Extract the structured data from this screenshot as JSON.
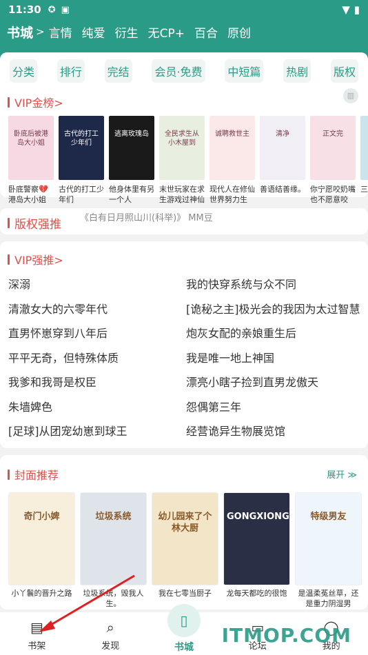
{
  "status": {
    "time": "11:30"
  },
  "topnav": {
    "main": "书城",
    "items": [
      "言情",
      "纯爱",
      "衍生",
      "无CP+",
      "百合",
      "原创"
    ]
  },
  "tabs": [
    "分类",
    "排行",
    "完结",
    "会员·免费",
    "中短篇",
    "热剧",
    "版权"
  ],
  "vip_rank": {
    "title": "VIP金榜>",
    "books": [
      {
        "title": "卧底警察💔港岛大小姐",
        "cover": "#f6d9e2",
        "cover_text": "卧底后被港岛大小姐"
      },
      {
        "title": "古代的打工少年们",
        "cover": "#1e2848",
        "cover_text": "古代的打工少年们"
      },
      {
        "title": "他身体里有另一个人",
        "cover": "#1a1a1a",
        "cover_text": "逃离玫瑰岛"
      },
      {
        "title": "末世玩家在求生游戏过神仙",
        "cover": "#e9efe0",
        "cover_text": "全民求生从小木屋到"
      },
      {
        "title": "现代人在修仙世界努力生",
        "cover": "#fbe9e9",
        "cover_text": "诚聘救世主"
      },
      {
        "title": "善语结善缘。",
        "cover": "#f2eef5",
        "cover_text": "清净"
      },
      {
        "title": "你宁愿咬奶嘴也不愿意咬",
        "cover": "#f8e1e6",
        "cover_text": "正文完"
      },
      {
        "title": "三",
        "cover": "#c9e4ea",
        "cover_text": ""
      }
    ]
  },
  "copyright": {
    "title": "版权强推",
    "scroll": "《白有日月照山川(科举)》 MM豆"
  },
  "vip_push": {
    "title": "VIP强推>",
    "left": [
      "深溺",
      "清澈女大的六零年代",
      "直男怀崽穿到八年后",
      "平平无奇，但特殊体质",
      "我爹和我哥是权臣",
      "朱墙婢色",
      "[足球]从团宠幼崽到球王"
    ],
    "right": [
      "我的快穿系统与众不同",
      "[诡秘之主]极光会的我因为太过智慧",
      "炮灰女配的亲娘重生后",
      "我是唯一地上神国",
      "漂亮小瞎子捡到直男龙傲天",
      "怨偶第三年",
      "经营诡异生物展览馆"
    ]
  },
  "cover_recommend": {
    "title": "封面推荐",
    "expand_label": "展开 ≫",
    "books": [
      {
        "title": "小丫鬟的晋升之路",
        "cover": "#f7eedc",
        "cover_text": "奇门小婢"
      },
      {
        "title": "垃圾系统，毁我人生。",
        "cover": "#dfe3ea",
        "cover_text": "垃圾系统"
      },
      {
        "title": "我在七零当厨子",
        "cover": "#f3e6c8",
        "cover_text": "幼儿园来了个林大厨"
      },
      {
        "title": "龙每天都吃的很饱",
        "cover": "#2a2f45",
        "cover_text": "GONGXIONG"
      },
      {
        "title": "是温柔菟丝草，还是重力阴湿男",
        "cover": "#eef6fb",
        "cover_text": "特级男友"
      }
    ]
  },
  "bottomnav": [
    {
      "label": "书架",
      "icon": "bookshelf-icon"
    },
    {
      "label": "发现",
      "icon": "search-icon"
    },
    {
      "label": "书城",
      "icon": "book-icon"
    },
    {
      "label": "论坛",
      "icon": "forum-icon"
    },
    {
      "label": "我的",
      "icon": "profile-icon"
    }
  ],
  "watermark": "ITMOP.COM"
}
